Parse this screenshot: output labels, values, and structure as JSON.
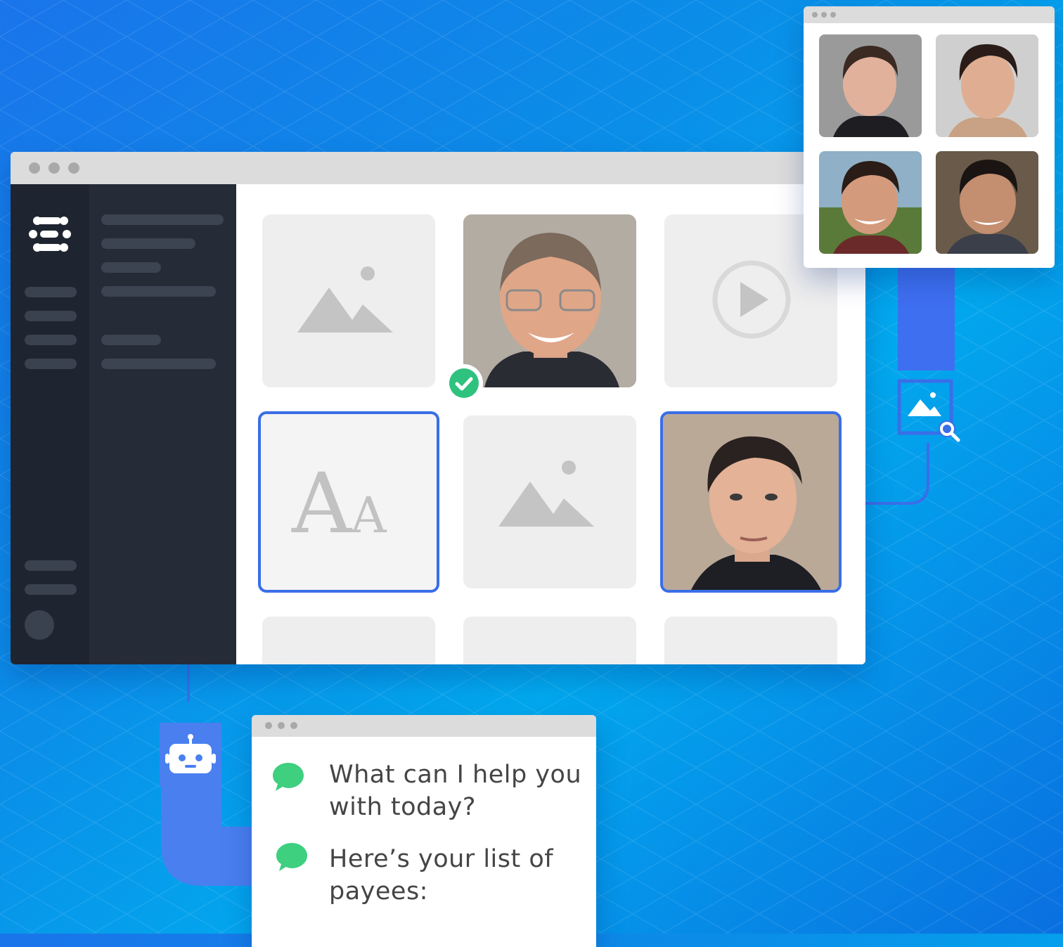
{
  "colors": {
    "accent_blue": "#3a6ee8",
    "connector_blue": "#4a7ff0",
    "sidebar_dark": "#1f2530",
    "sidebar_panel": "#252c38",
    "check_green": "#2ec27e",
    "chat_bubble_green": "#3ecf7f"
  },
  "icons": {
    "logo": "brand-logo-icon",
    "image": "image-placeholder-icon",
    "video": "play-icon",
    "text": "text-aa-icon",
    "check": "check-icon",
    "search": "image-search-icon",
    "bot": "robot-icon",
    "chat": "chat-bubble-icon"
  },
  "chat": {
    "messages": [
      {
        "text": "What can I help you with today?"
      },
      {
        "text": "Here’s your list of payees:"
      }
    ]
  }
}
